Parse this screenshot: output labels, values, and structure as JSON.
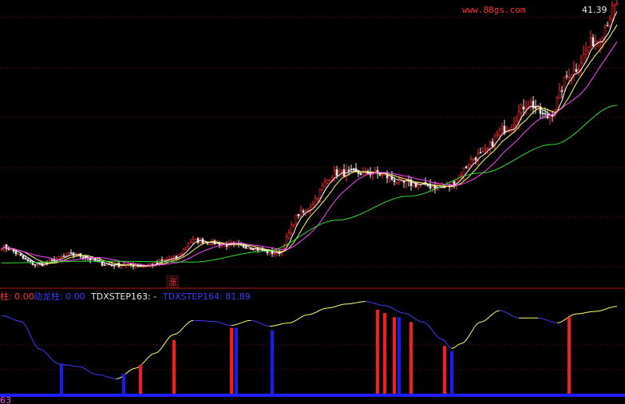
{
  "watermark": "www.88gs.com",
  "top_right_price": "41.39",
  "zhang_label": "涨",
  "indicator_labels": [
    {
      "text": "柱: 0.00",
      "color": "#ff3030"
    },
    {
      "text": "动龙柱: 0.00",
      "color": "#3b3bff"
    },
    {
      "text": "TDXSTEP163: -",
      "color": "#e8e8e8"
    },
    {
      "text": "TDXSTEP164: 81.89",
      "color": "#3b3bff"
    }
  ],
  "bottom_left_label": "63",
  "colors": {
    "background": "#000000",
    "grid": "#7a1010",
    "candle_up": "#ff3030",
    "candle_down": "#e8e8e8",
    "ma5": "#ffffff",
    "ma10": "#ffff66",
    "ma20": "#ff44ff",
    "ma60": "#33dd33",
    "osc_rising": "#ffff66",
    "osc_falling": "#3b3bff",
    "bar_red": "#ff1a1a",
    "bar_blue": "#1a1aff",
    "baseline": "#2020ff",
    "watermark": "#ff3030"
  },
  "chart_data": {
    "type": "line",
    "main": {
      "y_range": [
        11,
        41.5
      ],
      "close_anchors": [
        [
          0,
          14.3
        ],
        [
          15,
          12.3
        ],
        [
          30,
          13.4
        ],
        [
          45,
          12.3
        ],
        [
          60,
          12.2
        ],
        [
          72,
          13.0
        ],
        [
          80,
          15.0
        ],
        [
          100,
          14.4
        ],
        [
          115,
          13.6
        ],
        [
          125,
          18.1
        ],
        [
          140,
          22.6
        ],
        [
          155,
          22.6
        ],
        [
          170,
          21.4
        ],
        [
          185,
          21.0
        ],
        [
          200,
          24.6
        ],
        [
          210,
          27.5
        ],
        [
          220,
          30.4
        ],
        [
          228,
          28.9
        ],
        [
          238,
          34.0
        ],
        [
          248,
          37.5
        ],
        [
          257,
          41.3
        ]
      ],
      "ma60_anchors": [
        [
          0,
          12.5
        ],
        [
          40,
          12.7
        ],
        [
          80,
          12.6
        ],
        [
          110,
          13.8
        ],
        [
          140,
          17.3
        ],
        [
          170,
          20.0
        ],
        [
          200,
          22.6
        ],
        [
          230,
          25.8
        ],
        [
          257,
          30.2
        ]
      ]
    },
    "oscillator": {
      "y_range": [
        0,
        100
      ],
      "line_anchors": [
        [
          0,
          95
        ],
        [
          8,
          88
        ],
        [
          16,
          54
        ],
        [
          24,
          36
        ],
        [
          32,
          33
        ],
        [
          40,
          23
        ],
        [
          48,
          18
        ],
        [
          56,
          31
        ],
        [
          64,
          49
        ],
        [
          72,
          72
        ],
        [
          80,
          89
        ],
        [
          88,
          88
        ],
        [
          96,
          83
        ],
        [
          104,
          89
        ],
        [
          112,
          82
        ],
        [
          120,
          86
        ],
        [
          128,
          96
        ],
        [
          136,
          104
        ],
        [
          144,
          109
        ],
        [
          152,
          112
        ],
        [
          160,
          107
        ],
        [
          168,
          98
        ],
        [
          176,
          87
        ],
        [
          184,
          66
        ],
        [
          188,
          55
        ],
        [
          192,
          61
        ],
        [
          200,
          87
        ],
        [
          208,
          101
        ],
        [
          216,
          92
        ],
        [
          224,
          92
        ],
        [
          232,
          86
        ],
        [
          240,
          97
        ],
        [
          248,
          100
        ],
        [
          257,
          106
        ]
      ],
      "bars": [
        {
          "i": 25,
          "color": "blue",
          "value": 36
        },
        {
          "i": 51,
          "color": "blue",
          "value": 24
        },
        {
          "i": 58,
          "color": "red",
          "value": 35
        },
        {
          "i": 72,
          "color": "red",
          "value": 65
        },
        {
          "i": 96,
          "color": "red",
          "value": 80
        },
        {
          "i": 98,
          "color": "blue",
          "value": 80
        },
        {
          "i": 113,
          "color": "blue",
          "value": 77
        },
        {
          "i": 157,
          "color": "red",
          "value": 102
        },
        {
          "i": 160,
          "color": "red",
          "value": 98
        },
        {
          "i": 164,
          "color": "red",
          "value": 93
        },
        {
          "i": 166,
          "color": "blue",
          "value": 93
        },
        {
          "i": 171,
          "color": "red",
          "value": 87
        },
        {
          "i": 185,
          "color": "red",
          "value": 58
        },
        {
          "i": 188,
          "color": "blue",
          "value": 52
        },
        {
          "i": 237,
          "color": "red",
          "value": 93
        }
      ]
    }
  }
}
